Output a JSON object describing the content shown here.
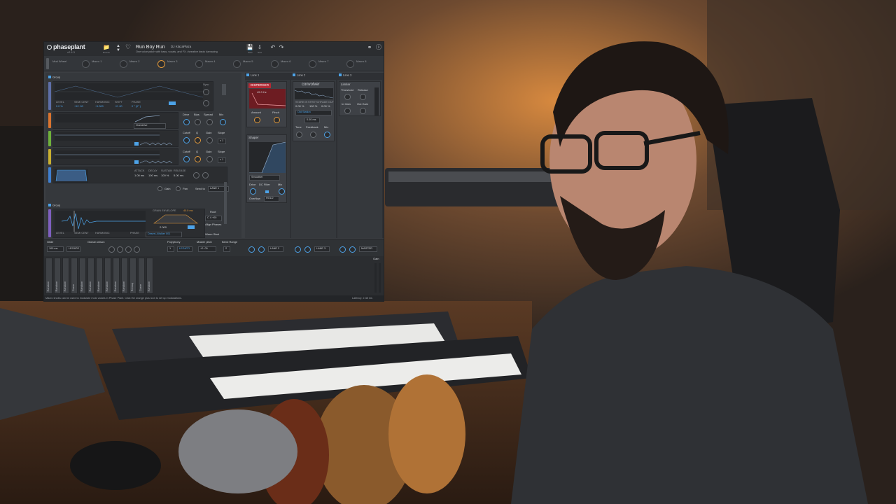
{
  "app": {
    "logo": "phaseplant",
    "version": "v2.4.3"
  },
  "toolbar": {
    "browse_label": "Browse",
    "preset_name": "Run Boy Run",
    "preset_author": "DJ KlazaPlaza",
    "preset_description": "One voice patch with bass, vocals, and FX. #creative #epic #amazing",
    "save_label": "Save",
    "save_as_label": "New"
  },
  "macros": {
    "mod_wheel_label": "Mod Wheel",
    "items": [
      "Macro 1",
      "Macro 2",
      "Macro 3",
      "Macro 4",
      "Macro 5",
      "Macro 6",
      "Macro 7",
      "Macro 8"
    ]
  },
  "generators": {
    "group1_label": "Group",
    "group2_label": "Group",
    "osc_params": {
      "level_label": "LEVEL",
      "level_val": "0.0 %",
      "semi_label": "SEMI CENT",
      "semi_val": "+12 .00",
      "harm_label": "HARMONIC",
      "harm_val": "+1.000",
      "shift_label": "SHIFT",
      "shift_val": "+0 .00",
      "phase_label": "PHASE",
      "phase_val": "0 ° (0° )"
    },
    "sync_label": "Sync",
    "distortion_select": "Overdrive",
    "dist_knobs": [
      "Drive",
      "Bias",
      "Spread",
      "Mix"
    ],
    "filter_knobs": [
      "Cutoff",
      "Q",
      "Gain",
      "Slope"
    ],
    "slope_val": "x 1",
    "env_params": [
      "ATTACK",
      "DECAY",
      "SUSTAIN",
      "RELEASE"
    ],
    "env_vals": [
      "1.00 ms",
      "100 ms",
      "100 %",
      "5.00 ms"
    ],
    "gain_label": "Gain",
    "pan_label": "Pan",
    "send_to_label": "Send to",
    "send_to_val": "LANE 1",
    "grain_label": "GRAIN ENVELOPE",
    "grain_val": "40.0 ms",
    "root_label": "Root",
    "root_val": "C 4 +00",
    "align_label": "Align Phases",
    "warm_label": "Warm Start",
    "sample_name": "Desert_Walker 001",
    "grain_count": "2.000"
  },
  "lanes": {
    "lane1_label": "Lane 1",
    "lane2_label": "Lane 2",
    "lane3_label": "Lane 3",
    "dispersion": "DISPERSER",
    "dispersion_freq": "45.3 Hz",
    "dispersion_knobs": [
      "Amount",
      "Pinch"
    ],
    "convolver": "convolver",
    "conv_labels": [
      "STARE IN",
      "STRETCH",
      "FADE OUT"
    ],
    "conv_vals": [
      "0.00 %",
      "100 %",
      "0.00 %"
    ],
    "conv_select": "Old Station",
    "conv_delay": "0.00 ms",
    "conv_knobs": [
      "Tone",
      "Feedback",
      "Mix"
    ],
    "limiter": "Limiter",
    "limiter_knobs": [
      "Threshold",
      "Release",
      "In Gain",
      "Out Gain"
    ],
    "shaper": "Shaper",
    "shaper_select": "Smoother",
    "shaper_knobs": [
      "Drive",
      "DC Filter",
      "Mix"
    ],
    "overflow_label": "Overflow",
    "overflow_val": "HOLD"
  },
  "bottom": {
    "glide_label": "Glide",
    "glide_val": "100 ms",
    "global_unison_label": "Global unison",
    "legato_label": "LEGATO",
    "polyphony_label": "Polyphony",
    "polyphony_val": "1",
    "master_pitch_label": "Master pitch",
    "master_pitch_val": "+0 .00",
    "bend_label": "Bend Range",
    "bend_val": "2",
    "lane_sends": [
      "LANE 2",
      "LANE 3",
      "MASTER"
    ]
  },
  "modulators": [
    "Random",
    "Random",
    "Random",
    "Curve",
    "Random",
    "Random",
    "Random",
    "Random",
    "Random",
    "Random",
    "Remap",
    "Curve",
    "Random"
  ],
  "mod_gain_label": "Gain",
  "status_text": "Macro knobs can be used to modulate most values in Phase Plant. Click the orange plus icon to set up modulations.",
  "status_right": "Latency: 2.38 ms"
}
